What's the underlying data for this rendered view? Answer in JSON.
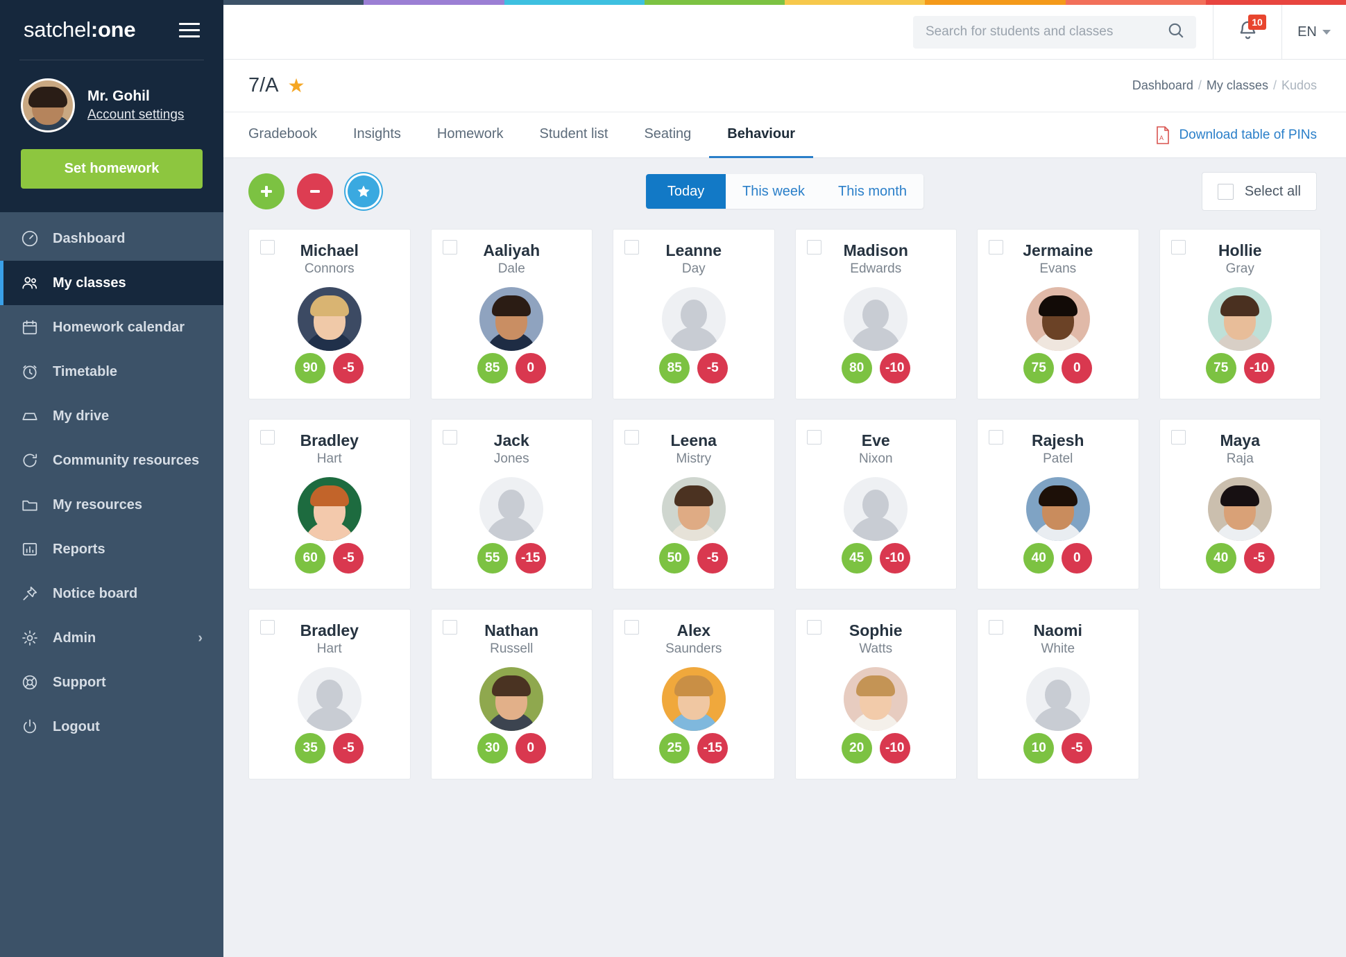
{
  "brand": {
    "light": "satchel",
    "bold": ":one"
  },
  "user": {
    "name": "Mr. Gohil",
    "account_link": "Account settings"
  },
  "sidebar": {
    "primary_button": "Set homework",
    "items": [
      {
        "label": "Dashboard",
        "icon": "speedometer-icon",
        "active": false,
        "chevron": ""
      },
      {
        "label": "My classes",
        "icon": "people-icon",
        "active": true,
        "chevron": ""
      },
      {
        "label": "Homework calendar",
        "icon": "calendar-icon",
        "active": false,
        "chevron": ""
      },
      {
        "label": "Timetable",
        "icon": "clock-icon",
        "active": false,
        "chevron": ""
      },
      {
        "label": "My drive",
        "icon": "drive-icon",
        "active": false,
        "chevron": ""
      },
      {
        "label": "Community resources",
        "icon": "refresh-icon",
        "active": false,
        "chevron": ""
      },
      {
        "label": "My resources",
        "icon": "folder-icon",
        "active": false,
        "chevron": ""
      },
      {
        "label": "Reports",
        "icon": "bar-chart-icon",
        "active": false,
        "chevron": ""
      },
      {
        "label": "Notice board",
        "icon": "pin-icon",
        "active": false,
        "chevron": ""
      },
      {
        "label": "Admin",
        "icon": "gear-icon",
        "active": false,
        "chevron": "›"
      },
      {
        "label": "Support",
        "icon": "lifebuoy-icon",
        "active": false,
        "chevron": ""
      },
      {
        "label": "Logout",
        "icon": "power-icon",
        "active": false,
        "chevron": ""
      }
    ]
  },
  "topbar": {
    "search_placeholder": "Search for students and classes",
    "search_value": "",
    "notification_count": "10",
    "language": "EN"
  },
  "page": {
    "title": "7/A",
    "starred": true,
    "breadcrumb": [
      "Dashboard",
      "My classes",
      "Kudos"
    ]
  },
  "tabs": [
    {
      "label": "Gradebook",
      "active": false
    },
    {
      "label": "Insights",
      "active": false
    },
    {
      "label": "Homework",
      "active": false
    },
    {
      "label": "Student list",
      "active": false
    },
    {
      "label": "Seating",
      "active": false
    },
    {
      "label": "Behaviour",
      "active": true
    }
  ],
  "download_link": "Download table of PINs",
  "toolbar": {
    "award_positive_label": "+",
    "award_negative_label": "–",
    "award_kudos_label": "★",
    "ranges": [
      {
        "label": "Today",
        "active": true
      },
      {
        "label": "This week",
        "active": false
      },
      {
        "label": "This month",
        "active": false
      }
    ],
    "select_all_label": "Select all",
    "select_all_checked": false
  },
  "colors": {
    "accent_blue": "#1279c6",
    "positive_green": "#7cc242",
    "negative_red": "#d9384f",
    "kudos_blue": "#3aa9e0",
    "brand_green": "#8dc63f",
    "sidebar": "#3c5268",
    "sidebar_dark": "#16283d",
    "star": "#f5a623"
  },
  "rainbow": [
    "#3c5268",
    "#9b7fd4",
    "#3ec0e0",
    "#7cc242",
    "#f6c84c",
    "#f49a1a",
    "#f2705a",
    "#e8453f"
  ],
  "students": [
    {
      "first": "Michael",
      "last": "Connors",
      "positive": "90",
      "negative": "-5",
      "photo": true,
      "skin": "#f0c9a8",
      "hair": "#d9b472",
      "bg": "#3c4a63",
      "body": "#20304a"
    },
    {
      "first": "Aaliyah",
      "last": "Dale",
      "positive": "85",
      "negative": "0",
      "photo": true,
      "skin": "#c98e63",
      "hair": "#2b1c14",
      "bg": "#8fa3bf",
      "body": "#1e2c44"
    },
    {
      "first": "Leanne",
      "last": "Day",
      "positive": "85",
      "negative": "-5",
      "photo": false,
      "skin": "",
      "hair": "",
      "bg": "",
      "body": ""
    },
    {
      "first": "Madison",
      "last": "Edwards",
      "positive": "80",
      "negative": "-10",
      "photo": false,
      "skin": "",
      "hair": "",
      "bg": "",
      "body": ""
    },
    {
      "first": "Jermaine",
      "last": "Evans",
      "positive": "75",
      "negative": "0",
      "photo": true,
      "skin": "#6b4226",
      "hair": "#120b07",
      "bg": "#e0b9a8",
      "body": "#efe6de"
    },
    {
      "first": "Hollie",
      "last": "Gray",
      "positive": "75",
      "negative": "-10",
      "photo": true,
      "skin": "#e8bd99",
      "hair": "#4a3020",
      "bg": "#bfe0d8",
      "body": "#d8cfc6"
    },
    {
      "first": "Bradley",
      "last": "Hart",
      "positive": "60",
      "negative": "-5",
      "photo": true,
      "skin": "#f3c9ac",
      "hair": "#c2642a",
      "bg": "#1d6b3f",
      "body": "#f3c9ac"
    },
    {
      "first": "Jack",
      "last": "Jones",
      "positive": "55",
      "negative": "-15",
      "photo": false,
      "skin": "",
      "hair": "",
      "bg": "",
      "body": ""
    },
    {
      "first": "Leena",
      "last": "Mistry",
      "positive": "50",
      "negative": "-5",
      "photo": true,
      "skin": "#dfab84",
      "hair": "#4b3221",
      "bg": "#cfd6cf",
      "body": "#e6e2d8"
    },
    {
      "first": "Eve",
      "last": "Nixon",
      "positive": "45",
      "negative": "-10",
      "photo": false,
      "skin": "",
      "hair": "",
      "bg": "",
      "body": ""
    },
    {
      "first": "Rajesh",
      "last": "Patel",
      "positive": "40",
      "negative": "0",
      "photo": true,
      "skin": "#c98c5d",
      "hair": "#1d1008",
      "bg": "#7fa3c4",
      "body": "#e9edf1"
    },
    {
      "first": "Maya",
      "last": "Raja",
      "positive": "40",
      "negative": "-5",
      "photo": true,
      "skin": "#d9a177",
      "hair": "#171012",
      "bg": "#cbbfae",
      "body": "#eceff2"
    },
    {
      "first": "Bradley",
      "last": "Hart",
      "positive": "35",
      "negative": "-5",
      "photo": false,
      "skin": "",
      "hair": "",
      "bg": "",
      "body": ""
    },
    {
      "first": "Nathan",
      "last": "Russell",
      "positive": "30",
      "negative": "0",
      "photo": true,
      "skin": "#e2b089",
      "hair": "#4a3322",
      "bg": "#8fa84e",
      "body": "#3c4450"
    },
    {
      "first": "Alex",
      "last": "Saunders",
      "positive": "25",
      "negative": "-15",
      "photo": true,
      "skin": "#f0c7a2",
      "hair": "#c98f45",
      "bg": "#f0a83c",
      "body": "#7fb8dd"
    },
    {
      "first": "Sophie",
      "last": "Watts",
      "positive": "20",
      "negative": "-10",
      "photo": true,
      "skin": "#f2cbaa",
      "hair": "#c49455",
      "bg": "#e7ccc0",
      "body": "#f4f0ea"
    },
    {
      "first": "Naomi",
      "last": "White",
      "positive": "10",
      "negative": "-5",
      "photo": false,
      "skin": "",
      "hair": "",
      "bg": "",
      "body": ""
    }
  ]
}
